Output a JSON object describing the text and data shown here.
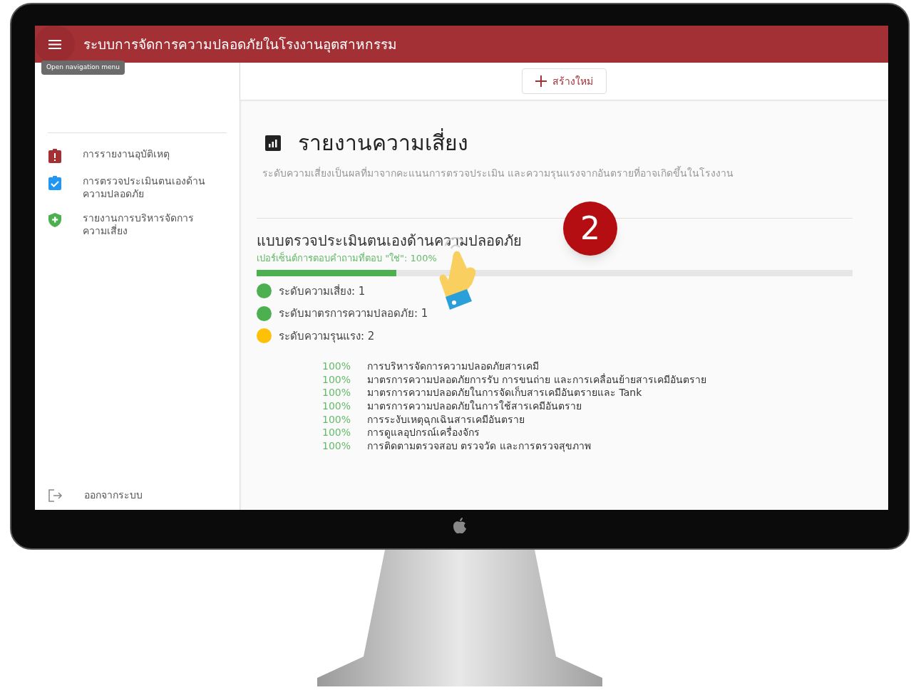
{
  "app_bar": {
    "title": "ระบบการจัดการความปลอดภัยในโรงงานอุตสาหกรรม",
    "menu_tooltip": "Open navigation menu"
  },
  "sidebar": {
    "items": [
      {
        "kind": "incident",
        "label": "การรายงานอุบัติเหตุ"
      },
      {
        "kind": "assessment",
        "label": "การตรวจประเมินตนเองด้านความปลอดภัย"
      },
      {
        "kind": "risk",
        "label": "รายงานการบริหารจัดการความเสี่ยง"
      }
    ],
    "logout": "ออกจากระบบ"
  },
  "toolbar": {
    "create_button": "สร้างใหม่"
  },
  "page": {
    "title": "รายงานความเสี่ยง",
    "subtitle": "ระดับความเสี่ยงเป็นผลที่มาจากคะแนนการตรวจประเมิน และความรุนแรงจากอันตรายที่อาจเกิดขึ้นในโรงงาน"
  },
  "section": {
    "title": "แบบตรวจประเมินตนเองด้านความปลอดภัย",
    "percent_label": "เปอร์เซ็นต์การตอบคำถามที่ตอบ \"ใช่\": 100%",
    "level": 0.235,
    "indicators": [
      {
        "label": "ระดับความเสี่ยง: 1",
        "color": "#4caf50"
      },
      {
        "label": "ระดับมาตรการความปลอดภัย: 1",
        "color": "#4caf50"
      },
      {
        "label": "ระดับความรุนแรง: 2",
        "color": "#ffc107"
      }
    ],
    "scores": [
      {
        "percent": "100%",
        "name": "การบริหารจัดการความปลอดภัยสารเคมี"
      },
      {
        "percent": "100%",
        "name": "มาตรการความปลอดภัยการรับ การขนถ่าย และการเคลื่อนย้ายสารเคมีอันตราย"
      },
      {
        "percent": "100%",
        "name": "มาตรการความปลอดภัยในการจัดเก็บสารเคมีอันตรายและ Tank"
      },
      {
        "percent": "100%",
        "name": "มาตรการความปลอดภัยในการใช้สารเคมีอันตราย"
      },
      {
        "percent": "100%",
        "name": "การระงับเหตุฉุกเฉินสารเคมีอันตราย"
      },
      {
        "percent": "100%",
        "name": "การดูแลอุปกรณ์เครื่องจักร"
      },
      {
        "percent": "100%",
        "name": "การติดตามตรวจสอบ ตรวจวัด และการตรวจสุขภาพ"
      }
    ]
  },
  "callout": {
    "number": "2"
  }
}
